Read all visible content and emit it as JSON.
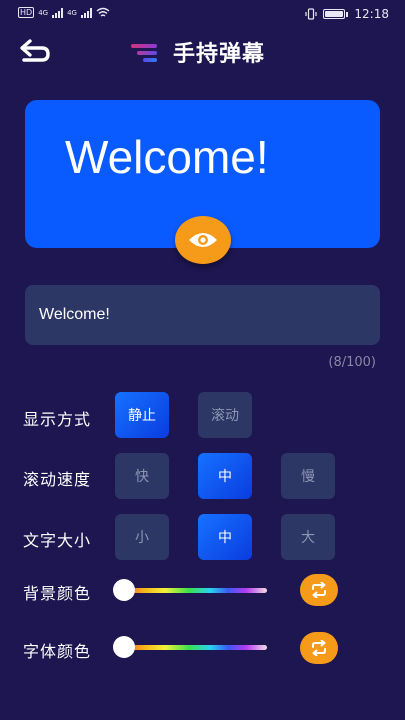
{
  "status_bar": {
    "hd_badge": "HD",
    "signal1_label": "4G",
    "signal2_label": "4G",
    "time": "12:18"
  },
  "header": {
    "title": "手持弹幕",
    "icons": {
      "back": "back-arrow-icon",
      "logo": "barrage-logo-icon"
    }
  },
  "preview": {
    "text": "Welcome!",
    "background_color": "#0a5bff",
    "eye_icon": "eye-icon"
  },
  "input": {
    "value": "Welcome!",
    "counter": "(8/100)"
  },
  "display_mode": {
    "label": "显示方式",
    "options": [
      "静止",
      "滚动"
    ],
    "selected": "静止"
  },
  "scroll_speed": {
    "label": "滚动速度",
    "options": [
      "快",
      "中",
      "慢"
    ],
    "selected": "中"
  },
  "text_size": {
    "label": "文字大小",
    "options": [
      "小",
      "中",
      "大"
    ],
    "selected": "中"
  },
  "background_color": {
    "label": "背景颜色",
    "slider_level": 0,
    "reset_icon": "refresh-icon"
  },
  "font_color": {
    "label": "字体颜色",
    "slider_level": 0,
    "reset_icon": "refresh-icon"
  },
  "colors": {
    "page_background": "#1d1650",
    "accent_blue": "#0a5bff",
    "accent_orange": "#f59a19",
    "chip_background": "#2c3766"
  }
}
